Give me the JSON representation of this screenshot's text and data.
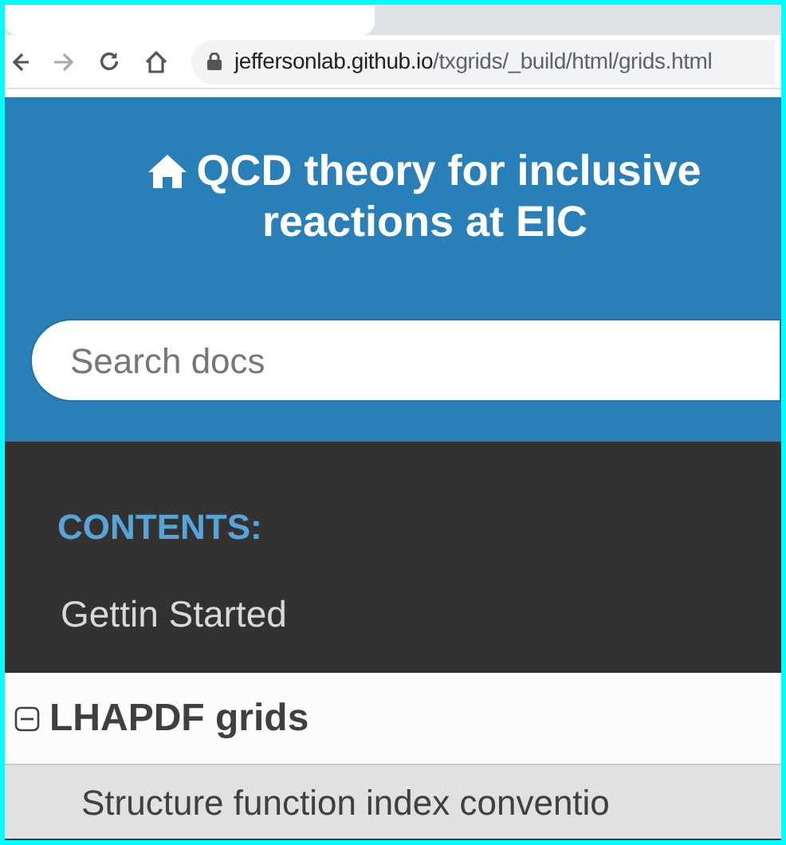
{
  "browser": {
    "address": {
      "host": "jeffersonlab.github.io",
      "path": "/txgrids/_build/html/grids.html"
    }
  },
  "header": {
    "title": "QCD theory for inclusive reactions at EIC",
    "search": {
      "placeholder": "Search docs"
    }
  },
  "sidebar": {
    "caption": "CONTENTS:",
    "items": [
      {
        "label": "Gettin Started",
        "kind": "link"
      },
      {
        "label": "LHAPDF grids",
        "kind": "toggle",
        "expanded": true,
        "selected": true,
        "children": [
          {
            "label": "Structure function index conventio"
          }
        ]
      }
    ]
  }
}
